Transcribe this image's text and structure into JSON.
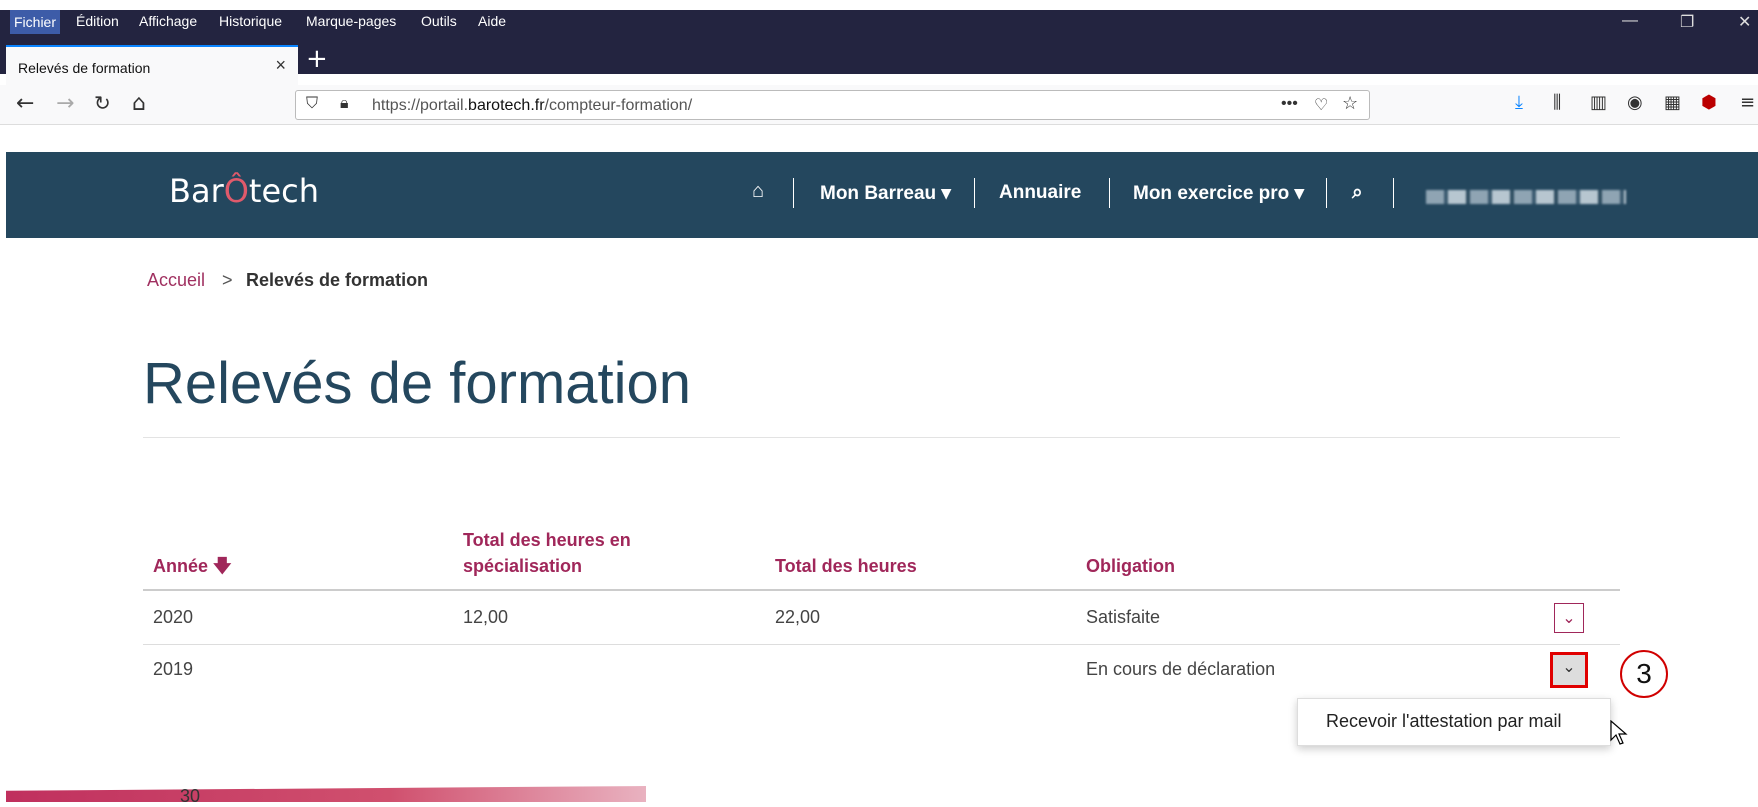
{
  "browser": {
    "menu": [
      "Fichier",
      "Édition",
      "Affichage",
      "Historique",
      "Marque-pages",
      "Outils",
      "Aide"
    ],
    "tab_title": "Relevés de formation",
    "url_prefix": "https://portail.",
    "url_domain": "barotech.fr",
    "url_path": "/compteur-formation/"
  },
  "site": {
    "logo_pre": "Bar",
    "logo_o": "Ô",
    "logo_post": "tech",
    "nav": [
      "Mon Barreau ▾",
      "Annuaire",
      "Mon exercice pro ▾"
    ]
  },
  "breadcrumb": {
    "home": "Accueil",
    "separator": ">",
    "current": "Relevés de formation"
  },
  "page_title": "Relevés de formation",
  "table": {
    "headers": [
      "Année",
      "Total des heures en",
      "spécialisation",
      "Total des heures",
      "Obligation"
    ],
    "rows": [
      {
        "annee": "2020",
        "specialisation": "12,00",
        "total": "22,00",
        "obligation": "Satisfaite"
      },
      {
        "annee": "2019",
        "specialisation": "",
        "total": "",
        "obligation": "En cours de déclaration"
      }
    ]
  },
  "dropdown_menu": {
    "item": "Recevoir l'attestation par mail"
  },
  "callout_number": "3",
  "footer_page": "30",
  "colors": {
    "accent": "#a0275a",
    "header_bg": "#24475e",
    "highlight": "#e00000"
  }
}
